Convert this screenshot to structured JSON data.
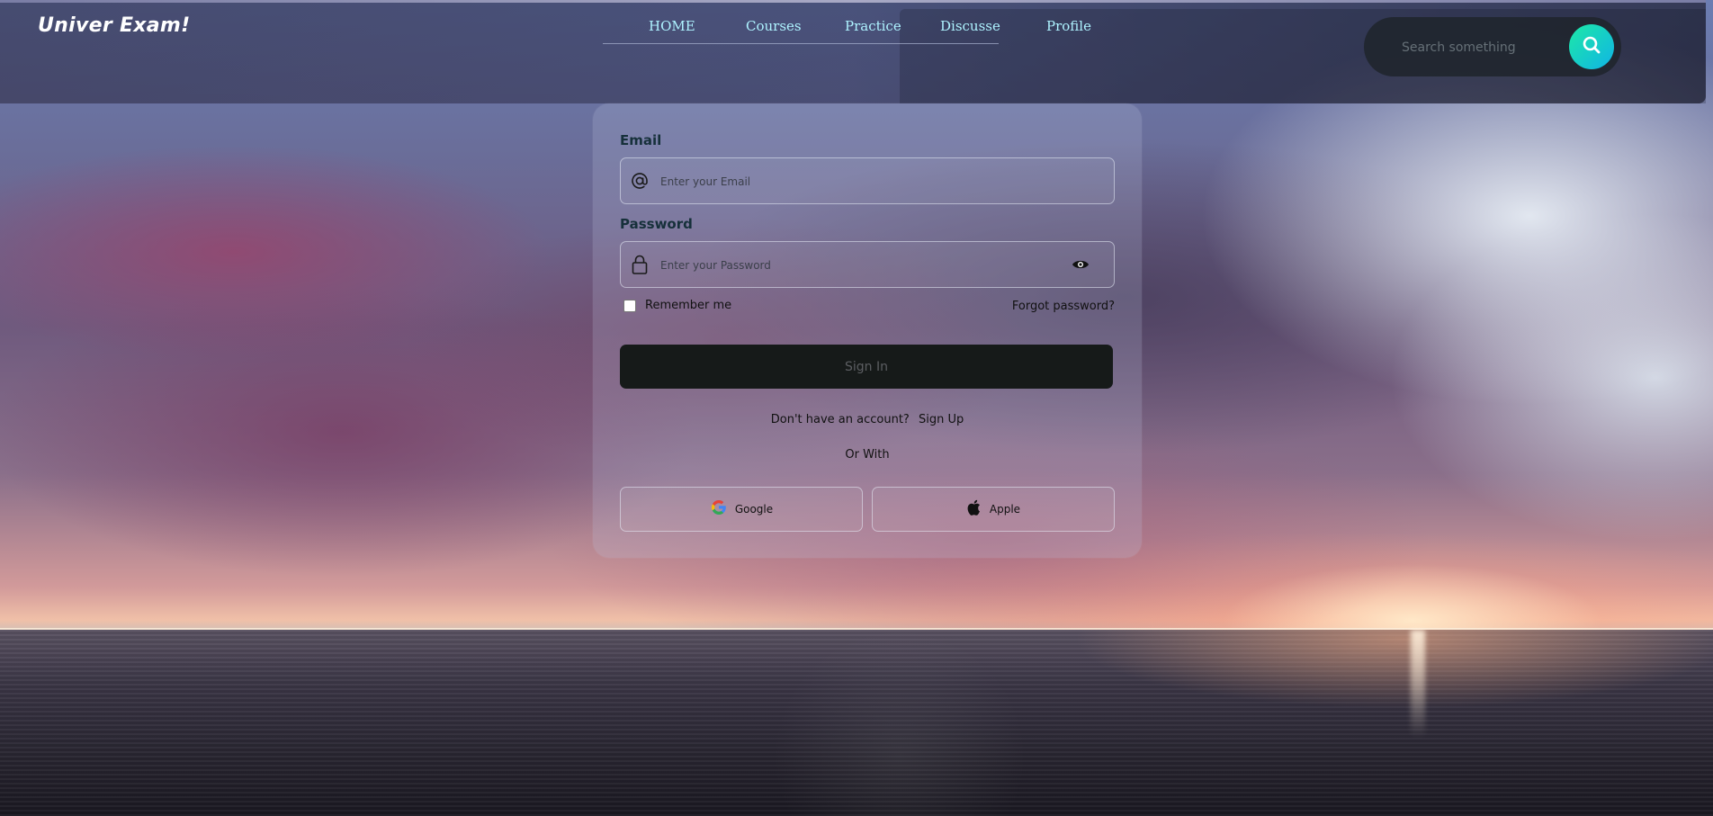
{
  "brand": {
    "logo": "Univer Exam!"
  },
  "nav": {
    "items": [
      {
        "label": "HOME"
      },
      {
        "label": "Courses"
      },
      {
        "label": "Practice"
      },
      {
        "label": "Discusse"
      },
      {
        "label": "Profile"
      }
    ]
  },
  "search": {
    "placeholder": "Search something",
    "icon": "search-icon"
  },
  "login": {
    "email_label": "Email",
    "email_placeholder": "Enter your Email",
    "email_icon": "at-sign-icon",
    "password_label": "Password",
    "password_placeholder": "Enter your Password",
    "password_icon": "lock-icon",
    "toggle_icon": "eye-icon",
    "remember_label": "Remember me",
    "remember_checked": false,
    "forgot_label": "Forgot password?",
    "signin_label": "Sign In",
    "no_account_text": "Don't have an account?",
    "signup_label": "Sign Up",
    "or_with": "Or With",
    "google_label": "Google",
    "google_icon": "google-icon",
    "apple_label": "Apple",
    "apple_icon": "apple-icon"
  },
  "colors": {
    "nav_text": "#aef3ff",
    "search_accent_start": "#1de9a6",
    "search_accent_end": "#10b4e6",
    "signin_bg": "#161a19",
    "label_text": "#16303a"
  }
}
